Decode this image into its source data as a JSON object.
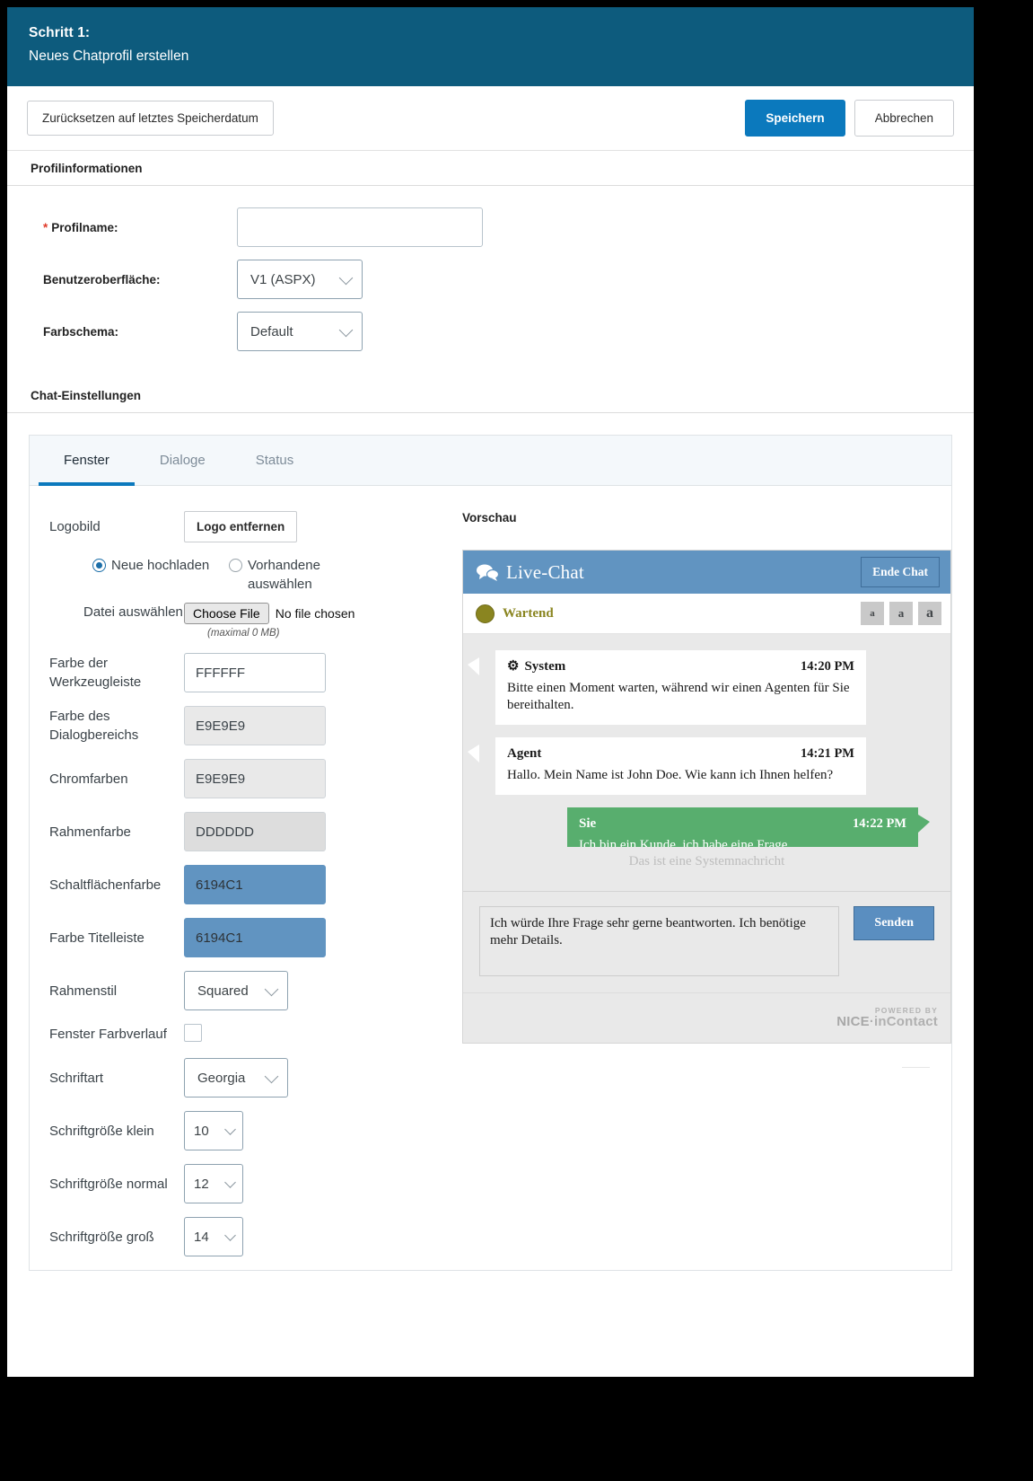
{
  "step": {
    "title": "Schritt 1:",
    "subtitle": "Neues Chatprofil erstellen"
  },
  "actions": {
    "reset_label": "Zurücksetzen auf letztes Speicherdatum",
    "save_label": "Speichern",
    "cancel_label": "Abbrechen"
  },
  "sections": {
    "profile_info": "Profilinformationen",
    "chat_settings": "Chat-Einstellungen"
  },
  "profile": {
    "name_label": "Profilname:",
    "name_required": "*",
    "name_value": "",
    "name_placeholder": "",
    "ui_label": "Benutzeroberfläche:",
    "ui_value": "V1 (ASPX)",
    "scheme_label": "Farbschema:",
    "scheme_value": "Default"
  },
  "tabs": [
    {
      "label": "Fenster",
      "active": true
    },
    {
      "label": "Dialoge",
      "active": false
    },
    {
      "label": "Status",
      "active": false
    }
  ],
  "window_settings": {
    "logo_label": "Logobild",
    "logo_remove_label": "Logo entfernen",
    "radio_new": "Neue hochladen",
    "radio_existing": "Vorhandene auswählen",
    "file_label": "Datei auswählen",
    "file_button": "Choose File",
    "file_status": "No file chosen",
    "file_max": "(maximal 0 MB)",
    "fields": [
      {
        "label": "Farbe der Werkzeugleiste",
        "value": "FFFFFF",
        "style": "white"
      },
      {
        "label": "Farbe des Dialogbereichs",
        "value": "E9E9E9",
        "style": "grey1"
      },
      {
        "label": "Chromfarben",
        "value": "E9E9E9",
        "style": "grey1"
      },
      {
        "label": "Rahmenfarbe",
        "value": "DDDDDD",
        "style": "grey2"
      },
      {
        "label": "Schaltflächenfarbe",
        "value": "6194C1",
        "style": "blue"
      },
      {
        "label": "Farbe Titelleiste",
        "value": "6194C1",
        "style": "blue"
      }
    ],
    "border_style_label": "Rahmenstil",
    "border_style_value": "Squared",
    "gradient_label": "Fenster Farbverlauf",
    "gradient_checked": false,
    "font_label": "Schriftart",
    "font_value": "Georgia",
    "size_small_label": "Schriftgröße klein",
    "size_small_value": "10",
    "size_normal_label": "Schriftgröße normal",
    "size_normal_value": "12",
    "size_large_label": "Schriftgröße groß",
    "size_large_value": "14"
  },
  "preview": {
    "title": "Vorschau",
    "chat_title": "Live-Chat",
    "end_chat_label": "Ende Chat",
    "status_text": "Wartend",
    "font_buttons": [
      "a",
      "a",
      "a"
    ],
    "messages": [
      {
        "sender": "System",
        "time": "14:20 PM",
        "text": "Bitte einen Moment warten, während wir einen Agenten für Sie bereithalten.",
        "direction": "in",
        "icon": "gear-icon"
      },
      {
        "sender": "Agent",
        "time": "14:21 PM",
        "text": "Hallo. Mein Name ist John Doe. Wie kann ich Ihnen helfen?",
        "direction": "in",
        "icon": ""
      },
      {
        "sender": "Sie",
        "time": "14:22 PM",
        "text": "Ich bin ein Kunde, ich habe eine Frage.",
        "direction": "out",
        "icon": ""
      }
    ],
    "system_note": "Das ist eine Systemnachricht",
    "compose_value": "Ich würde Ihre Frage sehr gerne beantworten. Ich benötige mehr Details.",
    "send_label": "Senden",
    "powered_top": "POWERED BY",
    "powered_brand": "NICE",
    "powered_brand2": "·inContact"
  },
  "colors": {
    "header_bg": "#0d5b7d",
    "primary": "#0b79bd",
    "chat_accent": "#6194C1",
    "outgoing_bubble": "#58ae6e",
    "status": "#8a8520"
  }
}
